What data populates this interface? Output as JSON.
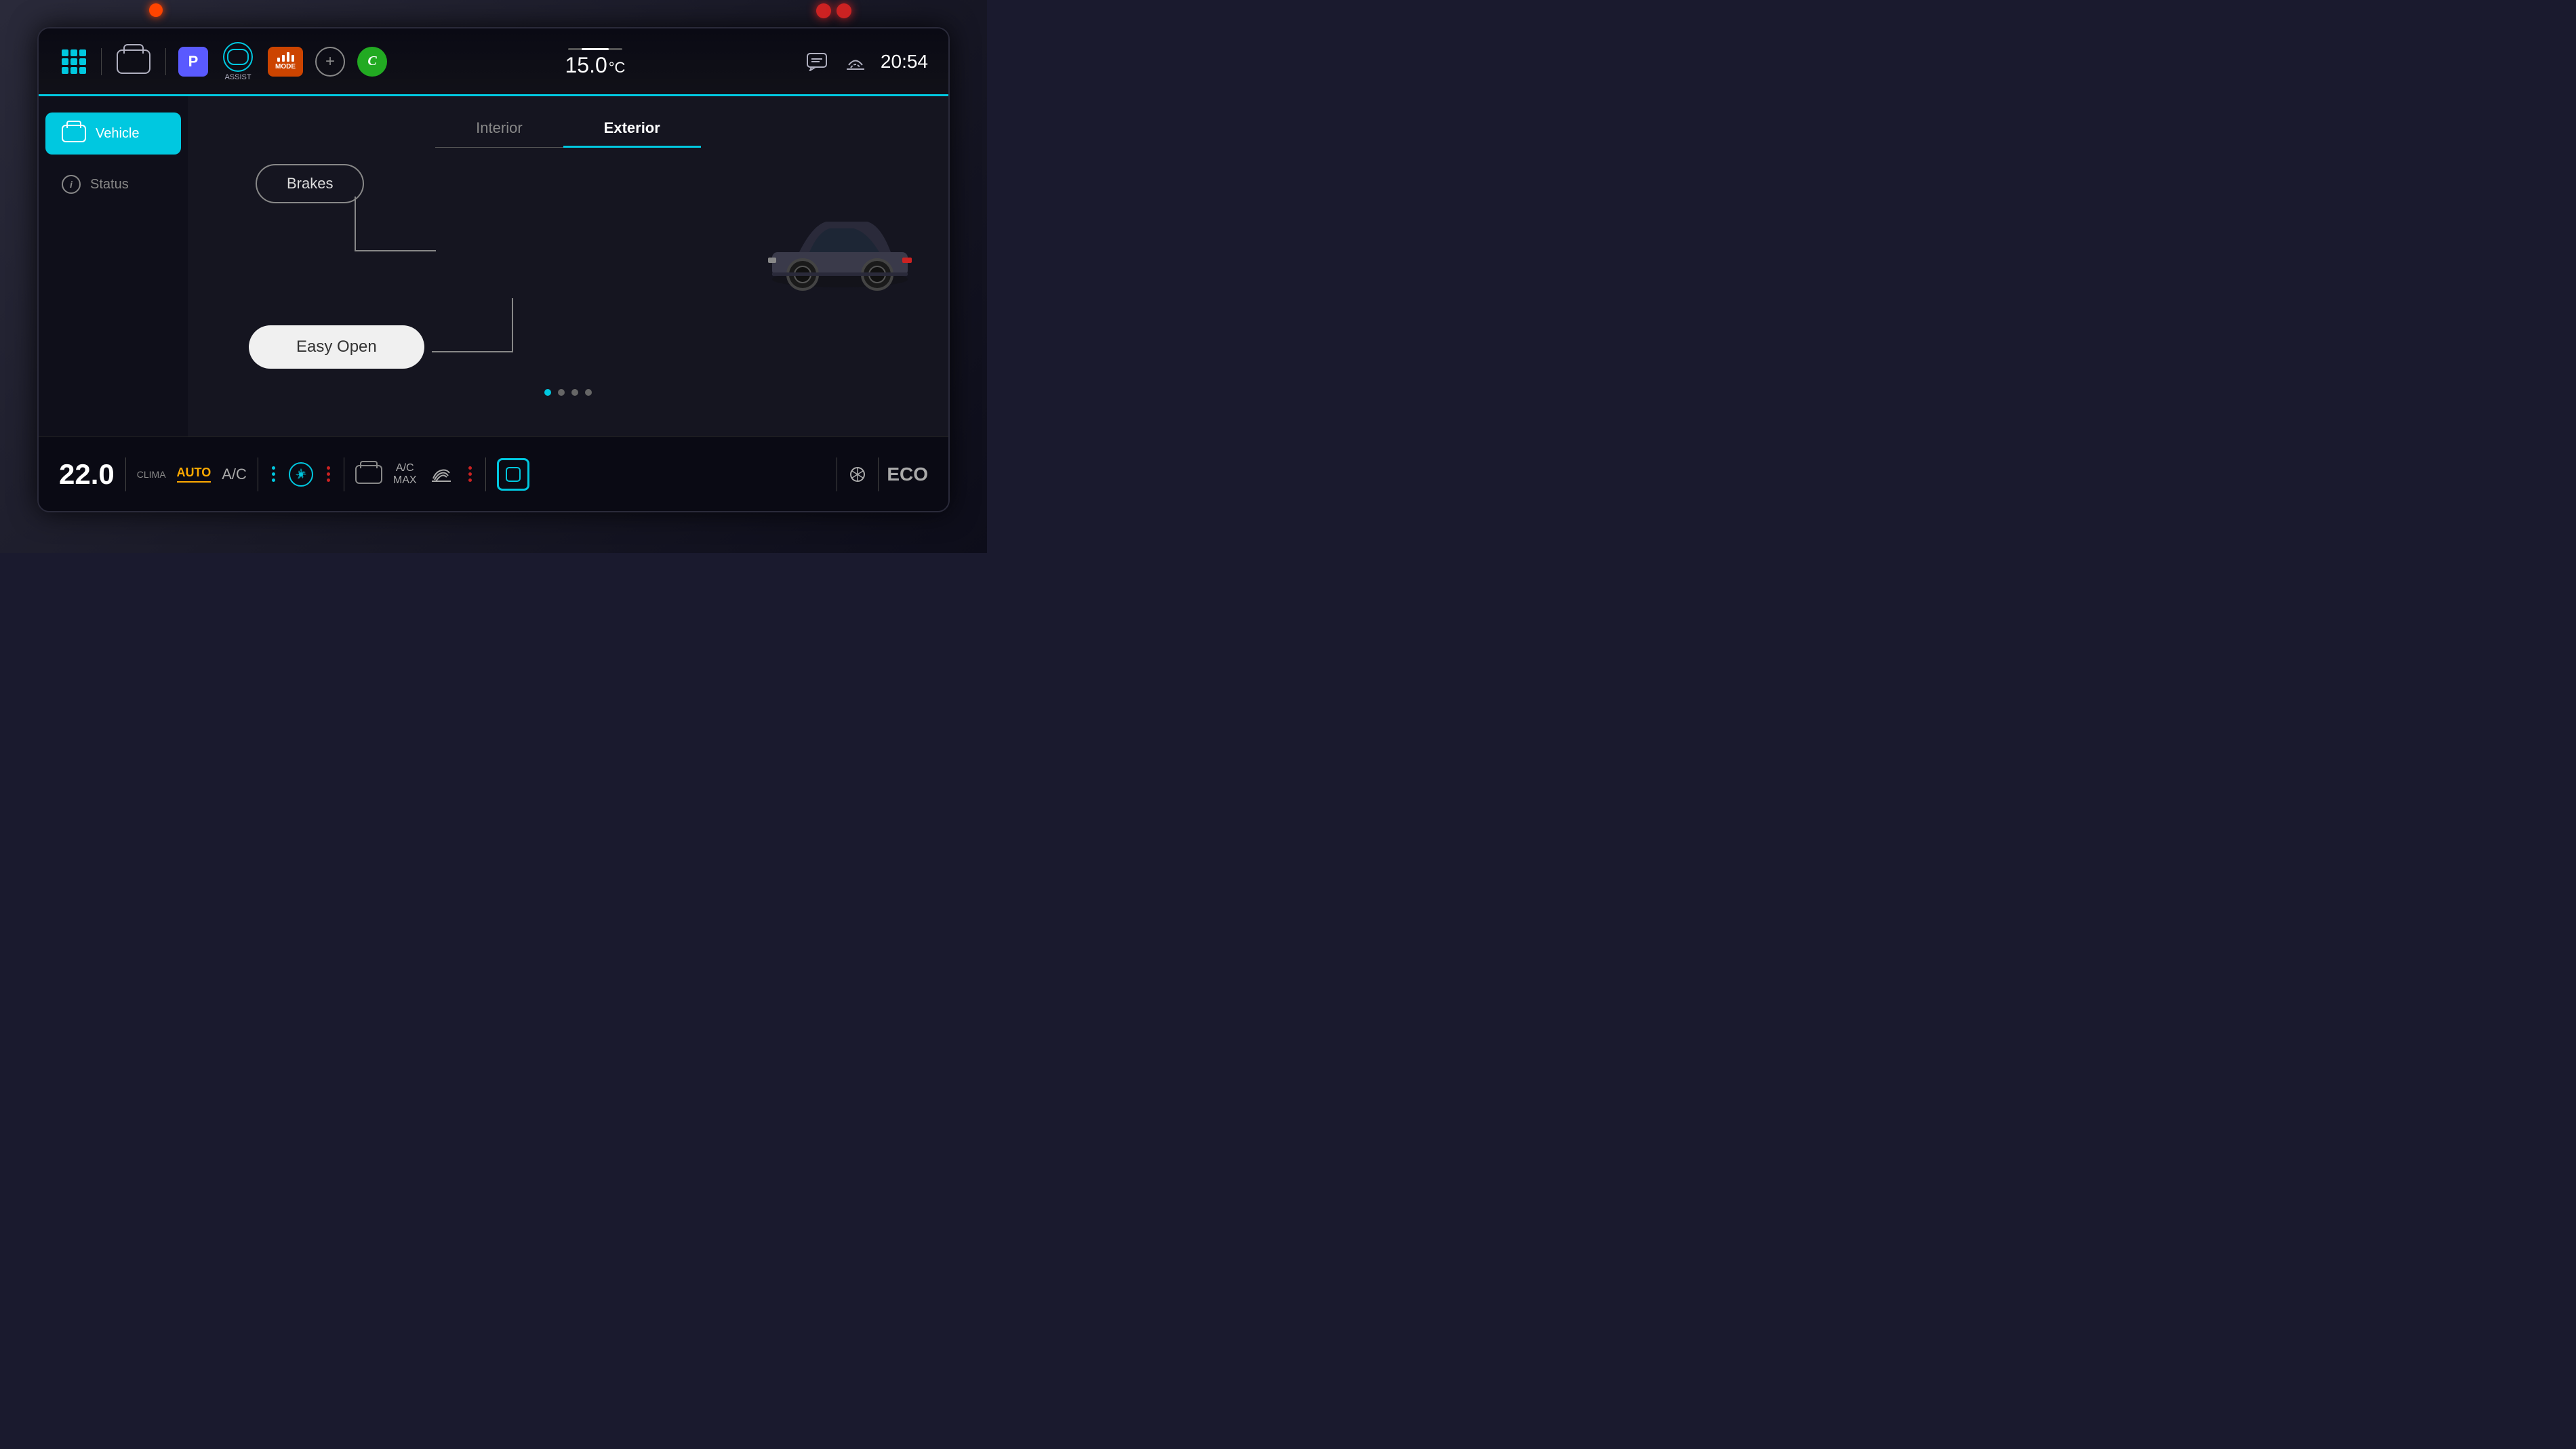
{
  "header": {
    "temperature": "15.0",
    "temp_unit": "°C",
    "time": "20:54",
    "parking_label": "P",
    "assist_label": "ASSIST",
    "mode_label": "MODE",
    "add_label": "+",
    "cruise_label": "C"
  },
  "sidebar": {
    "items": [
      {
        "id": "vehicle",
        "label": "Vehicle",
        "active": true
      },
      {
        "id": "status",
        "label": "Status",
        "active": false
      }
    ]
  },
  "tabs": [
    {
      "id": "interior",
      "label": "Interior",
      "active": false
    },
    {
      "id": "exterior",
      "label": "Exterior",
      "active": true
    }
  ],
  "controls": {
    "brakes_label": "Brakes",
    "easy_open_label": "Easy Open"
  },
  "bottom_bar": {
    "temperature": "22.0",
    "clima_label": "CLIMA",
    "auto_label": "AUTO",
    "ac_label": "A/C",
    "ac_max_label": "A/C\nMAX",
    "eco_label": "ECO"
  },
  "dots": [
    {
      "active": true
    },
    {
      "active": false
    },
    {
      "active": false
    },
    {
      "active": false
    }
  ],
  "icons": {
    "grid": "grid-icon",
    "car_top": "car-top-icon",
    "parking": "parking-icon",
    "assist": "assist-icon",
    "mode": "mode-icon",
    "add": "add-icon",
    "cruise_control": "cruise-control-icon",
    "chat": "chat-icon",
    "wifi": "wifi-icon",
    "sidebar_vehicle": "sidebar-vehicle-icon",
    "sidebar_status": "sidebar-status-icon",
    "fan": "fan-icon",
    "defrost": "defrost-icon",
    "vent": "vent-icon",
    "square": "square-icon",
    "car_bottom": "car-bottom-icon"
  }
}
